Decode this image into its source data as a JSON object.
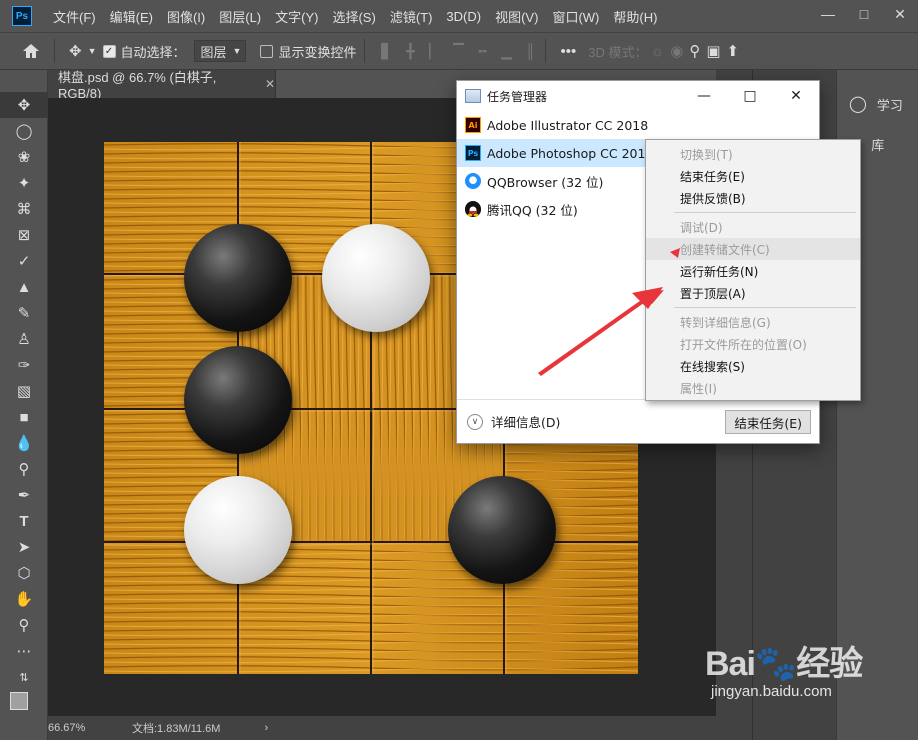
{
  "menubar": {
    "logo": "Ps",
    "items": [
      "文件(F)",
      "编辑(E)",
      "图像(I)",
      "图层(L)",
      "文字(Y)",
      "选择(S)",
      "滤镜(T)",
      "3D(D)",
      "视图(V)",
      "窗口(W)",
      "帮助(H)"
    ]
  },
  "options": {
    "auto_select_label": "自动选择：",
    "auto_select_target": "图层",
    "show_transform_label": "显示变换控件",
    "mode_3d_label": "3D 模式："
  },
  "document": {
    "tab_title": "棋盘.psd @ 66.7% (白棋子, RGB/8)",
    "zoom": "66.67%",
    "doc_info": "文档:1.83M/11.6M"
  },
  "panels": {
    "learn": "学习",
    "library": "库"
  },
  "task_manager": {
    "title": "任务管理器",
    "apps": [
      {
        "name": "Adobe Illustrator CC 2018",
        "icon": "ai-icon",
        "icon_text": "Ai"
      },
      {
        "name": "Adobe Photoshop CC 2019",
        "icon": "ps-icon",
        "icon_text": "Ps"
      },
      {
        "name": "QQBrowser (32 位)",
        "icon": "qqbrowser-icon",
        "icon_text": ""
      },
      {
        "name": "腾讯QQ (32 位)",
        "icon": "qq-icon",
        "icon_text": ""
      }
    ],
    "details_label": "详细信息(D)",
    "end_task_button": "结束任务(E)"
  },
  "context_menu": {
    "switch_to": "切换到(T)",
    "end_task": "结束任务(E)",
    "feedback": "提供反馈(B)",
    "debug": "调试(D)",
    "create_dump": "创建转储文件(C)",
    "run_new_task": "运行新任务(N)",
    "bring_to_front": "置于顶层(A)",
    "go_to_details": "转到详细信息(G)",
    "open_file_location": "打开文件所在的位置(O)",
    "search_online": "在线搜索(S)",
    "properties": "属性(I)"
  },
  "watermark": {
    "logo": "Bai🐾经验",
    "url": "jingyan.baidu.com"
  },
  "colors": {
    "ps_bg": "#535353",
    "canvas_bg": "#282828",
    "wood": "#d08a1a",
    "selected_row": "#cce8ff",
    "arrow": "#e8353b"
  }
}
